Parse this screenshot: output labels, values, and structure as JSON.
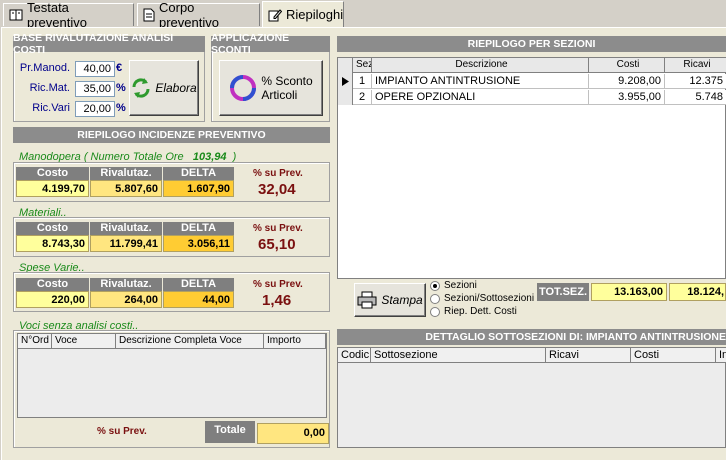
{
  "tabs": [
    {
      "label": "Testata preventivo",
      "icon": "book-icon"
    },
    {
      "label": "Corpo preventivo",
      "icon": "document-icon"
    },
    {
      "label": "Riepiloghi",
      "icon": "edit-icon"
    }
  ],
  "base": {
    "title": "BASE RIVALUTAZIONE ANALISI COSTI",
    "fields": [
      {
        "label": "Pr.Manod.",
        "value": "40,00",
        "unit": "€"
      },
      {
        "label": "Ric.Mat.",
        "value": "35,00",
        "unit": "%"
      },
      {
        "label": "Ric.Vari",
        "value": "20,00",
        "unit": "%"
      }
    ],
    "elabora_label": "Elabora"
  },
  "sconti": {
    "title": "APPLICAZIONE SCONTI",
    "button_line1": "% Sconto",
    "button_line2": "Articoli"
  },
  "incidenze": {
    "title": "RIEPILOGO INCIDENZE PREVENTIVO",
    "col_costo": "Costo",
    "col_rival": "Rivalutaz.",
    "col_delta": "DELTA",
    "pct_label": "% su Prev.",
    "manodopera": {
      "label": "Manodopera ( Numero Totale Ore",
      "ore": "103,94",
      "close": ")",
      "costo": "4.199,70",
      "rival": "5.807,60",
      "delta": "1.607,90",
      "pct": "32,04"
    },
    "materiali": {
      "label": "Materiali..",
      "costo": "8.743,30",
      "rival": "11.799,41",
      "delta": "3.056,11",
      "pct": "65,10"
    },
    "spese": {
      "label": "Spese Varie..",
      "costo": "220,00",
      "rival": "264,00",
      "delta": "44,00",
      "pct": "1,46"
    }
  },
  "voci": {
    "label": "Voci senza analisi costi..",
    "cols": [
      "N°Ord",
      "Voce",
      "Descrizione Completa Voce",
      "Importo"
    ],
    "pct_label": "% su Prev.",
    "totale_label": "Totale",
    "totale_value": "0,00"
  },
  "sezioni": {
    "title": "RIEPILOGO PER SEZIONI",
    "cols": [
      "Sezio",
      "Descrizione",
      "Costi",
      "Ricavi"
    ],
    "rows": [
      {
        "n": "1",
        "desc": "IMPIANTO ANTINTRUSIONE",
        "costi": "9.208,00",
        "ricavi": "12.375"
      },
      {
        "n": "2",
        "desc": "OPERE OPZIONALI",
        "costi": "3.955,00",
        "ricavi": "5.748"
      }
    ]
  },
  "stampa": {
    "label": "Stampa",
    "options": [
      "Sezioni",
      "Sezioni/Sottosezioni",
      "Riep. Dett. Costi"
    ],
    "selected": "Sezioni"
  },
  "totsez": {
    "label": "TOT.SEZ.",
    "costi": "13.163,00",
    "ricavi": "18.124,"
  },
  "dettaglio": {
    "title": "DETTAGLIO SOTTOSEZIONI DI: IMPIANTO ANTINTRUSIONE",
    "cols": [
      "Codic",
      "Sottosezione",
      "Ricavi",
      "Costi",
      "In"
    ]
  },
  "colors": {
    "header": "#8c8c8c",
    "green": "#1a8a1a",
    "maroon": "#7a1010",
    "yellow": "#ffff9c",
    "gold": "#ffcc33"
  }
}
